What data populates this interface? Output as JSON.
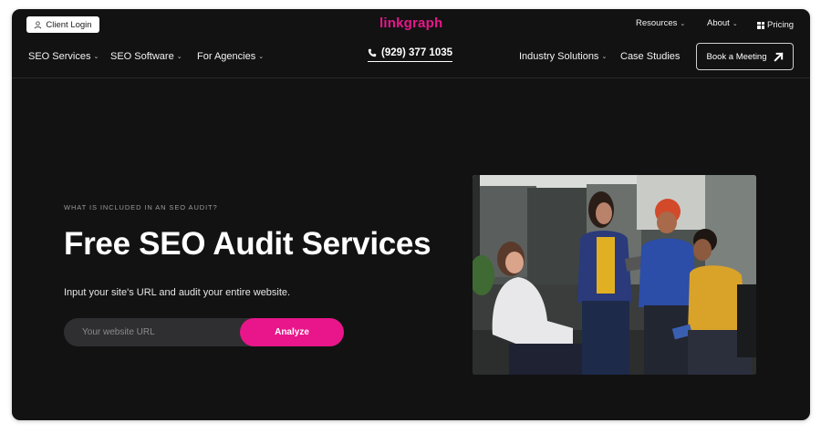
{
  "header": {
    "client_login": "Client Login",
    "logo": "linkgraph",
    "top_links": {
      "resources": "Resources",
      "about": "About",
      "pricing": "Pricing"
    },
    "nav": {
      "seo_services": "SEO Services",
      "seo_software": "SEO Software",
      "for_agencies": "For Agencies",
      "industry_solutions": "Industry Solutions",
      "case_studies": "Case Studies"
    },
    "phone": "(929) 377 1035",
    "cta": "Book a Meeting"
  },
  "hero": {
    "eyebrow": "WHAT IS INCLUDED IN AN SEO AUDIT?",
    "title": "Free SEO Audit Services",
    "subtitle": "Input your site's URL and audit your entire website.",
    "url_placeholder": "Your website URL",
    "analyze_label": "Analyze"
  },
  "colors": {
    "background": "#121213",
    "accent": "#e8168a",
    "text": "#ffffff",
    "input_bg": "#2f2f31"
  },
  "icons": {
    "client_login": "user-icon",
    "pricing": "grid-icon",
    "phone": "phone-icon",
    "cta": "arrow-up-right-icon",
    "dropdown": "chevron-down-icon"
  }
}
